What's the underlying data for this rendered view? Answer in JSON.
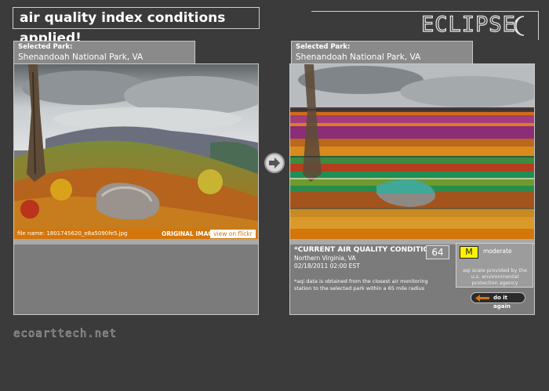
{
  "header": {
    "title": "air quality index conditions applied!",
    "logo_text": "ECLIPSE"
  },
  "left_panel": {
    "park_label": "Selected Park:",
    "park_name": "Shenandoah National Park, VA",
    "file_name": "file name: 1801745620_e8a5090fe5.jpg",
    "image_caption": "ORIGINAL IMAGE",
    "flickr_button": "view on flickr"
  },
  "right_panel": {
    "park_label": "Selected Park:",
    "park_name": "Shenandoah National Park, VA",
    "conditions_title": "*CURRENT AIR QUALITY CONDITIONS",
    "location": "Northern Virginia, VA",
    "datetime": "02/18/2011 02:00 EST",
    "aqi_value": "64",
    "aqi_letter": "M",
    "aqi_word": "moderate",
    "scale_note": "aqi scale provided by the u.s. environmental protection agency",
    "data_note": "*aqi data is obtained from the closest air monitoring station to the selected park within a 65 mile radius",
    "again_button": "do it again"
  },
  "footer": {
    "site": "ecoarttech.net"
  },
  "colors": {
    "background": "#3b3b3b",
    "accent_orange": "#d4760a",
    "aqi_yellow": "#fff200"
  },
  "icons": [
    "crescent-moon-icon",
    "arrow-right-icon",
    "arrow-left-icon"
  ]
}
